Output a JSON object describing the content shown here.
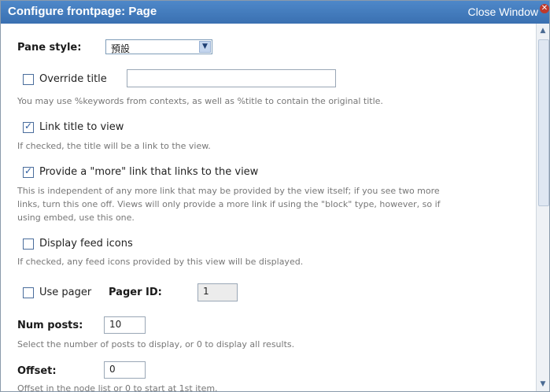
{
  "window": {
    "title": "Configure frontpage: Page",
    "close_label": "Close Window",
    "close_icon": "close-icon"
  },
  "pane_style": {
    "label": "Pane style:",
    "value": "預設"
  },
  "override_title": {
    "label": "Override title",
    "value": "",
    "checked": false,
    "description": "You may use %keywords from contexts, as well as %title to contain the original title."
  },
  "link_title": {
    "label": "Link title to view",
    "checked": true,
    "description": "If checked, the title will be a link to the view."
  },
  "more_link": {
    "label": "Provide a \"more\" link that links to the view",
    "checked": true,
    "description_lines": [
      "This is independent of any more link that may be provided by the view itself; if you see two more",
      "links, turn this one off. Views will only provide a more link if using the \"block\" type, however, so if",
      "using embed, use this one."
    ]
  },
  "feed_icons": {
    "label": "Display feed icons",
    "checked": false,
    "description": "If checked, any feed icons provided by this view will be displayed."
  },
  "pager": {
    "label": "Use pager",
    "checked": false,
    "id_label": "Pager ID:",
    "id_value": "1"
  },
  "num_posts": {
    "label": "Num posts:",
    "value": "10",
    "description": "Select the number of posts to display, or 0 to display all results."
  },
  "offset": {
    "label": "Offset:",
    "value": "0",
    "description": "Offset in the node list or 0 to start at 1st item."
  }
}
